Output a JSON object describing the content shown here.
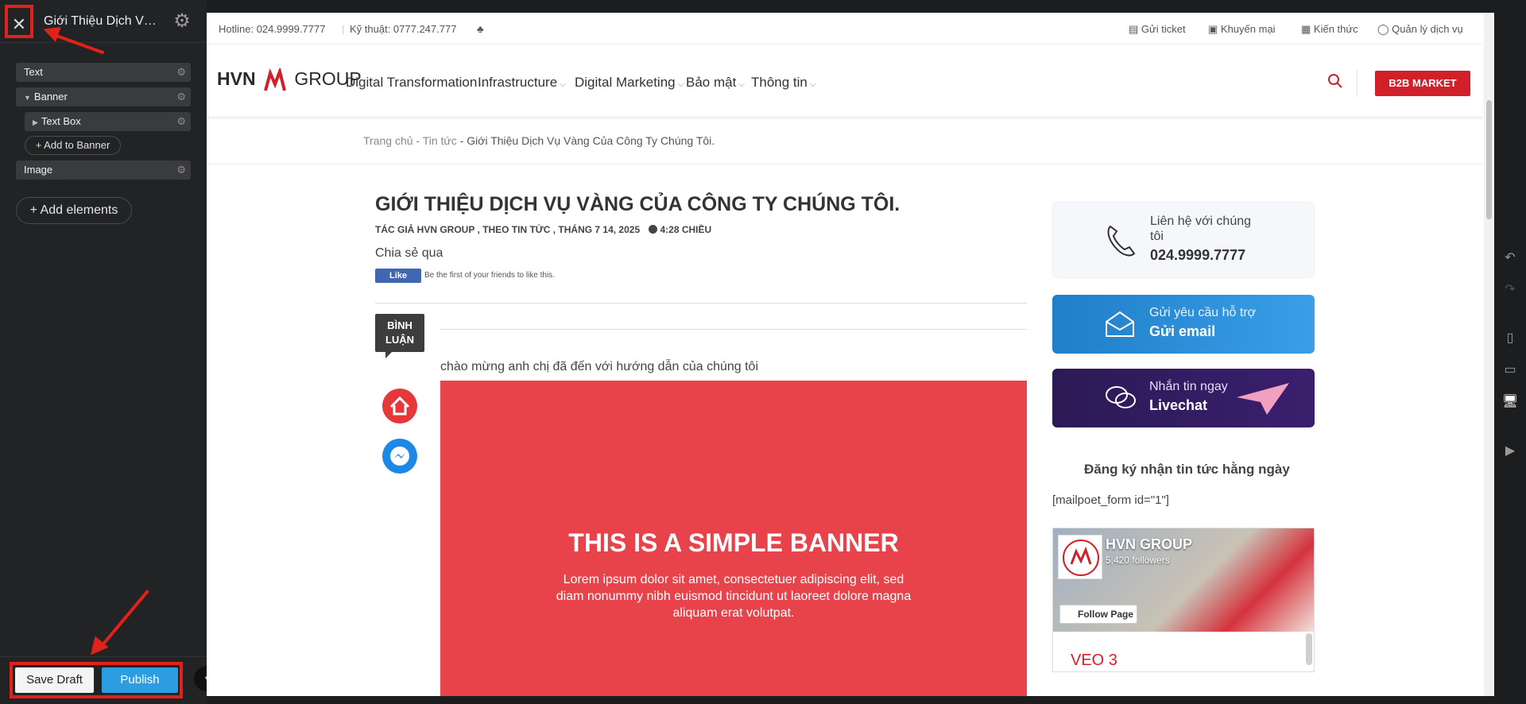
{
  "editor": {
    "title": "Giới Thiệu Dịch Vụ ...",
    "close_icon": "close-icon",
    "settings_icon": "gear-icon",
    "layers": [
      {
        "label": "Text"
      },
      {
        "label": "Banner"
      },
      {
        "label": "Text Box"
      },
      {
        "label": "Image"
      }
    ],
    "add_to_banner": "+ Add to Banner",
    "add_elements": "+ Add elements",
    "save_draft": "Save Draft",
    "publish": "Publish",
    "accent": "#2c9de0",
    "highlight": "#e0221b"
  },
  "site": {
    "topbar": {
      "hotline": "Hotline: 024.9999.7777",
      "tech": "Kỹ thuật: 0777.247.777",
      "links": [
        "Gửi ticket",
        "Khuyến mại",
        "Kiến thức",
        "Quản lý dịch vụ"
      ]
    },
    "logo": {
      "left": "HVN",
      "right": "GROUP"
    },
    "nav": [
      "Digital Transformation",
      "Infrastructure",
      "Digital Marketing",
      "Bảo mật",
      "Thông tin"
    ],
    "cta": "B2B MARKET",
    "breadcrumb": {
      "home": "Trang chủ",
      "sep": " - ",
      "section": "Tin tức",
      "current": "Giới Thiệu Dịch Vụ Vàng Của Công Ty Chúng Tôi."
    },
    "article": {
      "title": "GIỚI THIỆU DỊCH VỤ VÀNG CỦA CÔNG TY CHÚNG TÔI.",
      "meta": "TÁC GIẢ HVN GROUP , THEO TIN TỨC , THÁNG 7 14, 2025",
      "time": "4:28 CHIỀU",
      "share": "Chia sẻ qua",
      "like": "Like",
      "like_text": "Be the first of your friends to like this.",
      "comments": "BÌNH LUẬN",
      "welcome": "chào mừng anh chị đã đến với hướng dẫn của chúng tôi",
      "banner_title": "THIS IS A SIMPLE BANNER",
      "banner_text": "Lorem ipsum dolor sit amet, consectetuer adipiscing elit, sed diam nonummy nibh euismod tincidunt ut laoreet dolore magna aliquam erat volutpat.",
      "banner_color": "#e8424a"
    },
    "sidebar": {
      "contact_label": "Liên hệ với chúng tôi",
      "contact_phone": "024.9999.7777",
      "email_label": "Gửi yêu cầu hỗ trợ",
      "email_action": "Gửi email",
      "chat_label": "Nhắn tin ngay",
      "chat_action": "Livechat",
      "newsletter": "Đăng ký nhận tin tức hằng ngày",
      "mailpoet": "[mailpoet_form id=\"1\"]",
      "fb_name": "HVN GROUP",
      "fb_followers": "5,420 followers",
      "fb_follow": "Follow Page",
      "fb_post": "VEO 3"
    },
    "brand_red": "#d2202a"
  }
}
